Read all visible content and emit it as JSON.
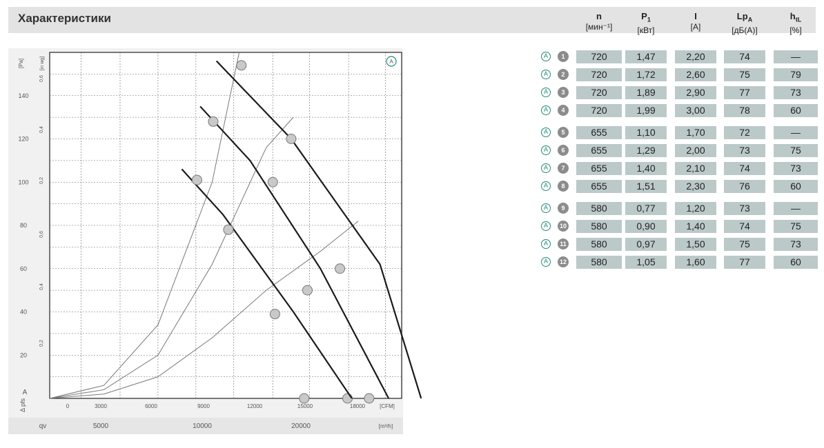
{
  "header": {
    "title": "Характеристики",
    "columns": [
      {
        "symbol": "n",
        "sub": "",
        "unit": "[мин⁻¹]"
      },
      {
        "symbol": "P",
        "sub": "1",
        "unit": "[кВт]"
      },
      {
        "symbol": "I",
        "sub": "",
        "unit": "[A]"
      },
      {
        "symbol": "Lp",
        "sub": "A",
        "unit": "[дБ(A)]"
      },
      {
        "symbol": "h",
        "sub": "tL",
        "unit": "[%]"
      }
    ]
  },
  "table": {
    "rows": [
      {
        "marker": "A",
        "num": "1",
        "n": "720",
        "p1": "1,47",
        "i": "2,20",
        "lpa": "74",
        "htl": "—"
      },
      {
        "marker": "A",
        "num": "2",
        "n": "720",
        "p1": "1,72",
        "i": "2,60",
        "lpa": "75",
        "htl": "79"
      },
      {
        "marker": "A",
        "num": "3",
        "n": "720",
        "p1": "1,89",
        "i": "2,90",
        "lpa": "77",
        "htl": "73"
      },
      {
        "marker": "A",
        "num": "4",
        "n": "720",
        "p1": "1,99",
        "i": "3,00",
        "lpa": "78",
        "htl": "60"
      },
      {
        "marker": "A",
        "num": "5",
        "n": "655",
        "p1": "1,10",
        "i": "1,70",
        "lpa": "72",
        "htl": "—"
      },
      {
        "marker": "A",
        "num": "6",
        "n": "655",
        "p1": "1,29",
        "i": "2,00",
        "lpa": "73",
        "htl": "75"
      },
      {
        "marker": "A",
        "num": "7",
        "n": "655",
        "p1": "1,40",
        "i": "2,10",
        "lpa": "74",
        "htl": "73"
      },
      {
        "marker": "A",
        "num": "8",
        "n": "655",
        "p1": "1,51",
        "i": "2,30",
        "lpa": "76",
        "htl": "60"
      },
      {
        "marker": "A",
        "num": "9",
        "n": "580",
        "p1": "0,77",
        "i": "1,20",
        "lpa": "73",
        "htl": "—"
      },
      {
        "marker": "A",
        "num": "10",
        "n": "580",
        "p1": "0,90",
        "i": "1,40",
        "lpa": "74",
        "htl": "75"
      },
      {
        "marker": "A",
        "num": "11",
        "n": "580",
        "p1": "0,97",
        "i": "1,50",
        "lpa": "75",
        "htl": "73"
      },
      {
        "marker": "A",
        "num": "12",
        "n": "580",
        "p1": "1,05",
        "i": "1,60",
        "lpa": "77",
        "htl": "60"
      }
    ]
  },
  "chart_data": {
    "type": "line",
    "x_axis": {
      "unit": "[m³/h]",
      "ticks": [
        5000,
        10000,
        20000
      ],
      "lim": [
        0,
        32500
      ]
    },
    "y_axis_pa": {
      "unit": "[Pa]",
      "ticks": [
        20,
        40,
        60,
        80,
        100,
        120,
        140
      ],
      "lim": [
        0,
        160
      ]
    },
    "y_axis_inwg": {
      "unit": "[in wg]",
      "ticks": [
        "0,2",
        "0,4",
        "0,6",
        "0,2",
        "0,4",
        "0,6"
      ]
    },
    "x_axis_cfm": {
      "unit": "[CFM]",
      "ticks": [
        0,
        3000,
        6000,
        9000,
        12000,
        15000,
        18000
      ]
    },
    "left_labels": {
      "pressure": "Δ pfs",
      "pressure_sub": "A",
      "flow": "qv"
    },
    "curve_marker": "A",
    "series": [
      {
        "speed_rpm": 720,
        "points": [
          [
            15400,
            156
          ],
          [
            22300,
            120
          ],
          [
            30500,
            62
          ],
          [
            34300,
            0
          ]
        ],
        "operating_points": [
          [
            17700,
            154
          ],
          [
            22300,
            120
          ],
          [
            26800,
            60
          ],
          [
            29500,
            0
          ]
        ]
      },
      {
        "speed_rpm": 655,
        "points": [
          [
            13900,
            135
          ],
          [
            18500,
            110
          ],
          [
            25000,
            60
          ],
          [
            31300,
            0
          ]
        ],
        "operating_points": [
          [
            15100,
            128
          ],
          [
            20600,
            100
          ],
          [
            23800,
            50
          ],
          [
            27500,
            0
          ]
        ]
      },
      {
        "speed_rpm": 580,
        "points": [
          [
            12200,
            106
          ],
          [
            16000,
            85
          ],
          [
            22500,
            40
          ],
          [
            27900,
            0
          ]
        ],
        "operating_points": [
          [
            13600,
            101
          ],
          [
            16500,
            78
          ],
          [
            20800,
            39
          ],
          [
            23500,
            0
          ]
        ]
      }
    ],
    "system_curves": [
      {
        "points": [
          [
            0,
            0
          ],
          [
            5000,
            6
          ],
          [
            10000,
            34
          ],
          [
            15000,
            100
          ],
          [
            17500,
            160
          ]
        ]
      },
      {
        "points": [
          [
            0,
            0
          ],
          [
            5000,
            4
          ],
          [
            10000,
            20
          ],
          [
            15000,
            62
          ],
          [
            20000,
            116
          ],
          [
            22500,
            130
          ]
        ]
      },
      {
        "points": [
          [
            0,
            0
          ],
          [
            5000,
            2
          ],
          [
            10000,
            10
          ],
          [
            15000,
            28
          ],
          [
            20000,
            50
          ],
          [
            25000,
            68
          ],
          [
            28500,
            82
          ]
        ]
      }
    ]
  }
}
